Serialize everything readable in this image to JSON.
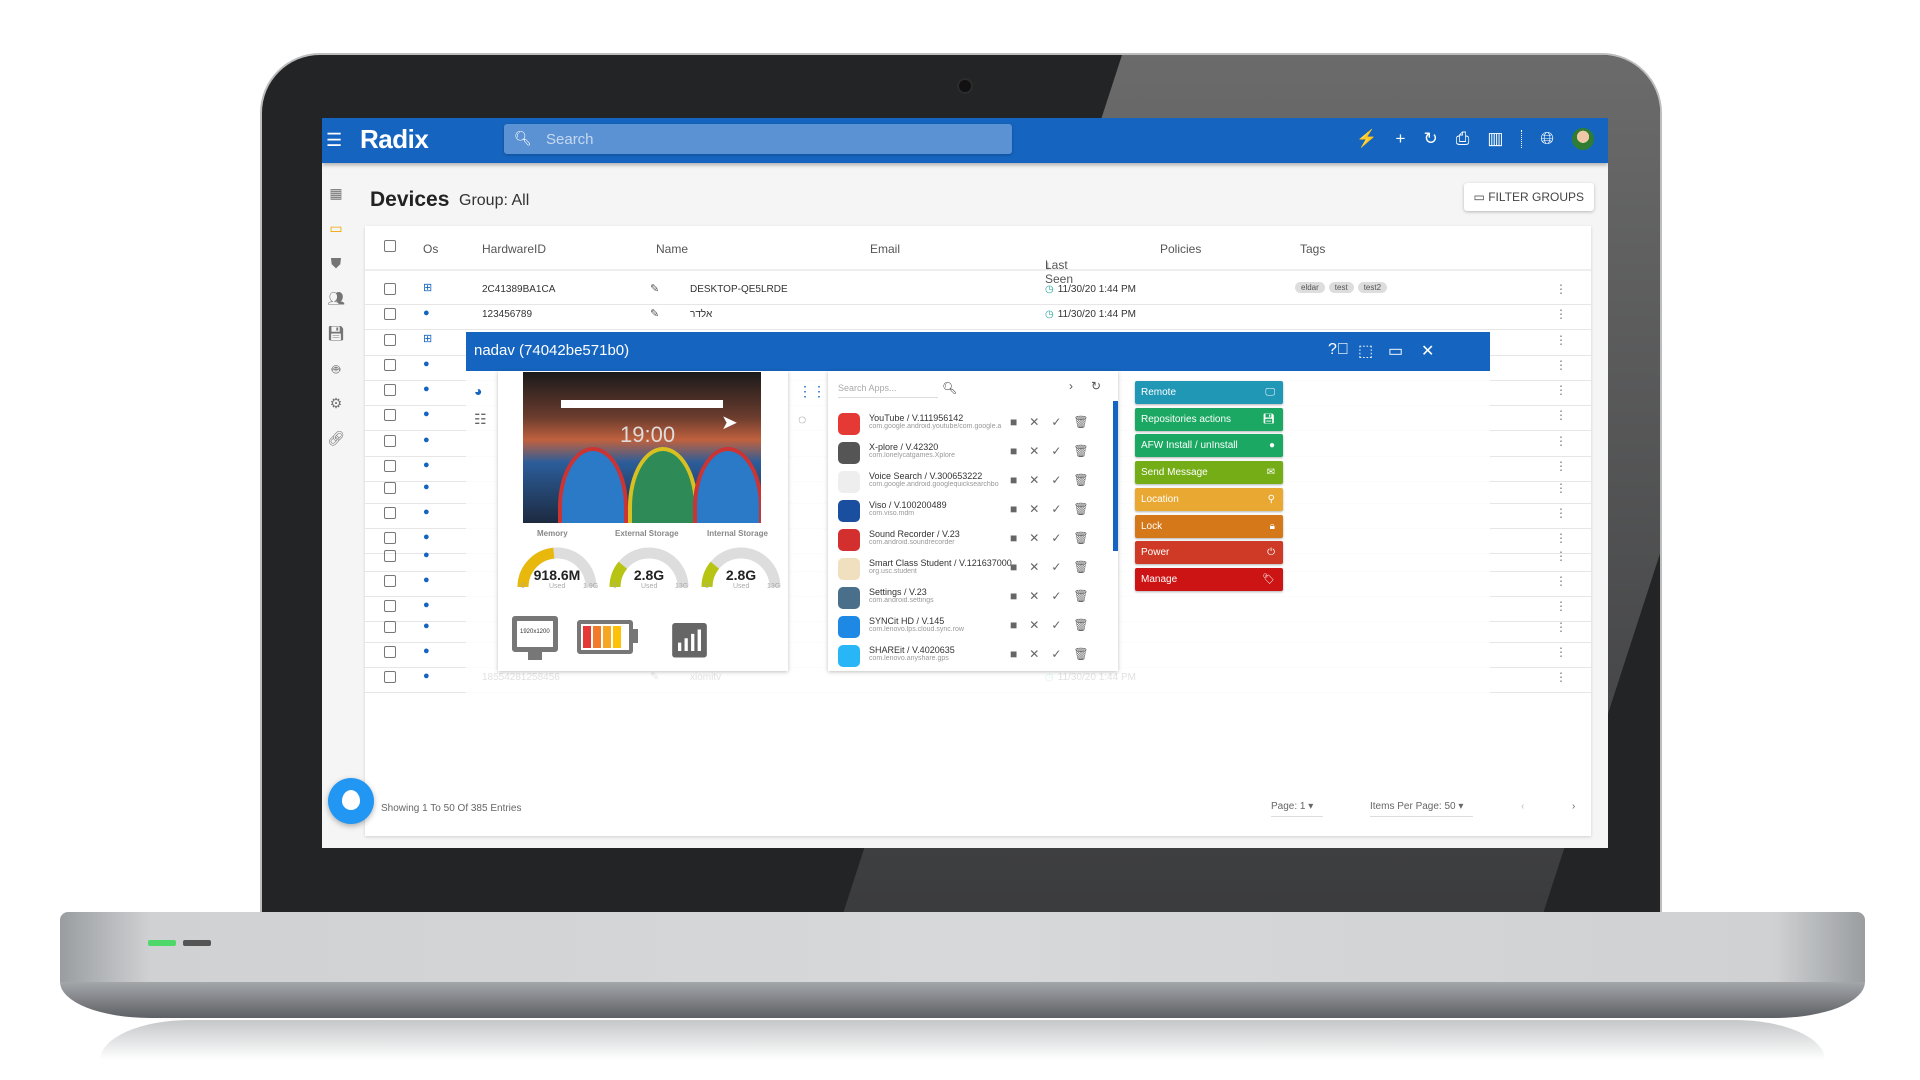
{
  "app": {
    "logo": "Radix",
    "search_placeholder": "Search"
  },
  "header": {
    "title": "Devices",
    "group": "Group: All",
    "filter_groups": "FILTER GROUPS"
  },
  "topbar_icons": [
    "plug-icon",
    "plus-icon",
    "refresh-icon",
    "print-icon",
    "columns-icon",
    "globe-icon",
    "avatar"
  ],
  "sidebar": {
    "items": [
      "dashboard",
      "devices",
      "policies",
      "users",
      "storage",
      "android",
      "settings-apps",
      "links"
    ]
  },
  "table": {
    "columns": [
      "Os",
      "HardwareID",
      "Name",
      "Email",
      "Last Seen",
      "Policies",
      "Tags"
    ],
    "sort_indicator": "↓",
    "rows": [
      {
        "os": "windows",
        "hw": "2C41389BA1CA",
        "name": "DESKTOP-QE5LRDE",
        "last_seen": "11/30/20 1:44 PM",
        "tags": [
          "eldar",
          "test",
          "test2"
        ]
      },
      {
        "os": "android",
        "hw": "123456789",
        "name": "אלדר",
        "last_seen": "11/30/20 1:44 PM",
        "tags": []
      },
      {
        "os": "windows",
        "hw": "",
        "name": "",
        "last_seen": "",
        "tags": []
      },
      {
        "os": "android",
        "hw": "",
        "name": "",
        "last_seen": "",
        "tags": []
      },
      {
        "os": "android",
        "hw": "",
        "name": "",
        "last_seen": "",
        "tags": []
      },
      {
        "os": "android",
        "hw": "",
        "name": "",
        "last_seen": "",
        "tags": []
      },
      {
        "os": "android",
        "hw": "",
        "name": "",
        "last_seen": "",
        "tags": []
      },
      {
        "os": "android",
        "hw": "",
        "name": "",
        "last_seen": "",
        "tags": []
      },
      {
        "os": "android",
        "hw": "",
        "name": "",
        "last_seen": "",
        "tags": []
      },
      {
        "os": "android",
        "hw": "",
        "name": "",
        "last_seen": "",
        "tags": []
      },
      {
        "os": "android",
        "hw": "",
        "name": "",
        "last_seen": "",
        "tags": []
      },
      {
        "os": "android",
        "hw": "",
        "name": "",
        "last_seen": "",
        "tags": []
      },
      {
        "os": "android",
        "hw": "",
        "name": "",
        "last_seen": "",
        "tags": []
      },
      {
        "os": "android",
        "hw": "",
        "name": "",
        "last_seen": "",
        "tags": []
      },
      {
        "os": "android",
        "hw": "",
        "name": "",
        "last_seen": "",
        "tags": []
      },
      {
        "os": "android",
        "hw": "",
        "name": "",
        "last_seen": "",
        "tags": []
      },
      {
        "os": "android",
        "hw": "18554281258456",
        "name": "xiomitv",
        "last_seen": "11/30/20 1:44 PM",
        "tags": []
      }
    ],
    "footer": {
      "showing": "Showing 1 To 50 Of 385 Entries",
      "page": "Page: 1",
      "items_per_page": "Items Per Page: 50"
    }
  },
  "dialog": {
    "title": "nadav (74042be571b0)",
    "screen_clock": "19:00",
    "gauges": [
      {
        "label": "Memory",
        "value": "918.6M",
        "sub": "Used",
        "min": "0",
        "max": "1.9G",
        "fraction": 0.47,
        "color": "#e8b80c"
      },
      {
        "label": "External Storage",
        "value": "2.8G",
        "sub": "Used",
        "min": "0",
        "max": "13G",
        "fraction": 0.22,
        "color": "#b8c414"
      },
      {
        "label": "Internal Storage",
        "value": "2.8G",
        "sub": "Used",
        "min": "0",
        "max": "13G",
        "fraction": 0.22,
        "color": "#b8c414"
      }
    ],
    "resolution": "1920x1200",
    "battery_level": 0.75,
    "apps_search_placeholder": "Search Apps...",
    "apps": [
      {
        "name": "YouTube / V.111956142",
        "pkg": "com.google.android.youtube/com.google.a",
        "color": "#e53935"
      },
      {
        "name": "X-plore / V.42320",
        "pkg": "com.lonelycatgames.Xplore",
        "color": "#555"
      },
      {
        "name": "Voice Search / V.300653222",
        "pkg": "com.google.android.googlequicksearchbo",
        "color": "#eee"
      },
      {
        "name": "Viso / V.100200489",
        "pkg": "com.viso.mdm",
        "color": "#1a4fa0"
      },
      {
        "name": "Sound Recorder / V.23",
        "pkg": "com.android.soundrecorder",
        "color": "#d32f2f"
      },
      {
        "name": "Smart Class Student / V.121637000",
        "pkg": "org.usc.student",
        "color": "#f0e0c0"
      },
      {
        "name": "Settings / V.23",
        "pkg": "com.android.settings",
        "color": "#4a6f8a"
      },
      {
        "name": "SYNCit HD / V.145",
        "pkg": "com.lenovo.lps.cloud.sync.row",
        "color": "#1e88e5"
      },
      {
        "name": "SHAREit / V.4020635",
        "pkg": "com.lenovo.anyshare.gps",
        "color": "#29b6f6"
      }
    ],
    "actions": [
      {
        "label": "Remote",
        "icon": "monitor-icon",
        "color": "#1f97b5"
      },
      {
        "label": "Repositories actions",
        "icon": "save-icon",
        "color": "#1ba862"
      },
      {
        "label": "AFW Install / unInstall",
        "icon": "android-icon",
        "color": "#1ba862"
      },
      {
        "label": "Send Message",
        "icon": "mail-icon",
        "color": "#74ad16"
      },
      {
        "label": "Location",
        "icon": "location-icon",
        "color": "#e8a832"
      },
      {
        "label": "Lock",
        "icon": "lock-icon",
        "color": "#d4781a"
      },
      {
        "label": "Power",
        "icon": "power-icon",
        "color": "#cf3a26"
      },
      {
        "label": "Manage",
        "icon": "tag-icon",
        "color": "#cc1414"
      }
    ]
  }
}
